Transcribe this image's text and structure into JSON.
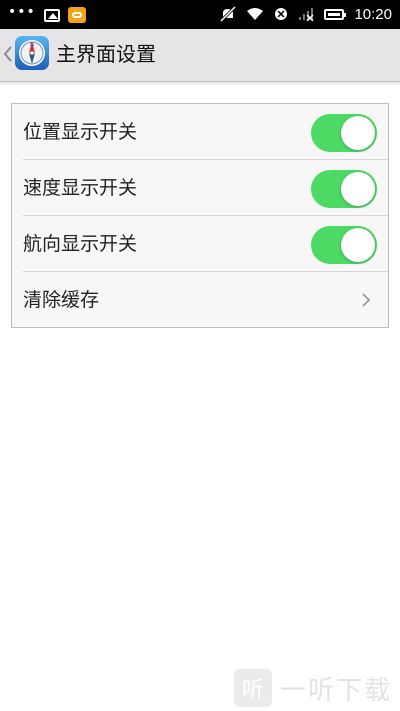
{
  "status_bar": {
    "time": "10:20",
    "left_icons": [
      "more-dots-icon",
      "image-icon",
      "game-icon"
    ],
    "right_icons": [
      "mute-icon",
      "wifi-icon",
      "sim-icon",
      "signal-off-icon",
      "battery-icon"
    ]
  },
  "header": {
    "title": "主界面设置",
    "back_icon": "chevron-left-icon",
    "app_icon": "compass-icon"
  },
  "settings": {
    "items": [
      {
        "label": "位置显示开关",
        "type": "toggle",
        "checked": true
      },
      {
        "label": "速度显示开关",
        "type": "toggle",
        "checked": true
      },
      {
        "label": "航向显示开关",
        "type": "toggle",
        "checked": true
      },
      {
        "label": "清除缓存",
        "type": "link"
      }
    ]
  },
  "watermark": {
    "logo_char": "听",
    "text": "一听下载"
  },
  "colors": {
    "toggle_on": "#4cd964",
    "header_bg": "#e5e5e5",
    "status_bar_bg": "#000000"
  }
}
